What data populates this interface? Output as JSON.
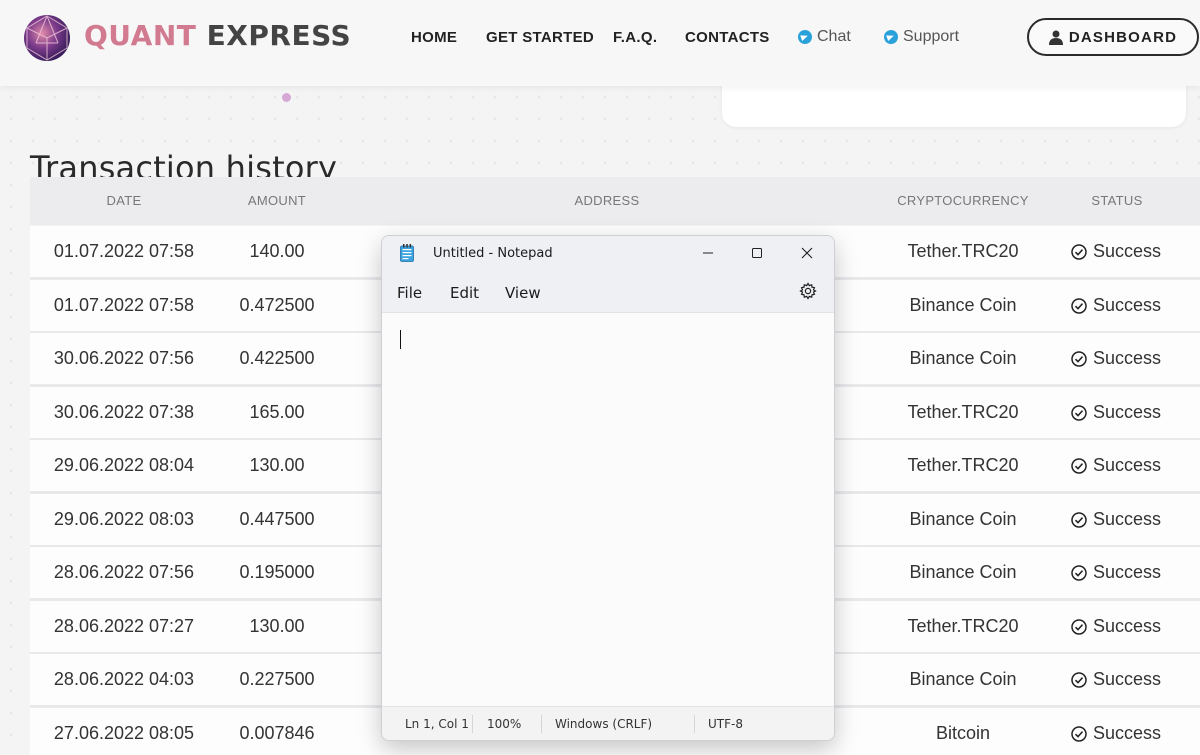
{
  "brand": {
    "part1": "QUANT",
    "part2": "EXPRESS"
  },
  "nav": {
    "home": "HOME",
    "get_started": "GET STARTED",
    "faq": "F.A.Q.",
    "contacts": "CONTACTS",
    "chat": "Chat",
    "support": "Support",
    "dashboard": "DASHBOARD"
  },
  "page_title": "Transaction history",
  "table": {
    "headers": {
      "date": "DATE",
      "amount": "AMOUNT",
      "address": "ADDRESS",
      "crypto": "CRYPTOCURRENCY",
      "status": "STATUS"
    },
    "rows": [
      {
        "date": "01.07.2022 07:58",
        "amount": "140.00",
        "crypto": "Tether.TRC20",
        "status": "Success"
      },
      {
        "date": "01.07.2022 07:58",
        "amount": "0.472500",
        "crypto": "Binance Coin",
        "status": "Success"
      },
      {
        "date": "30.06.2022 07:56",
        "amount": "0.422500",
        "crypto": "Binance Coin",
        "status": "Success"
      },
      {
        "date": "30.06.2022 07:38",
        "amount": "165.00",
        "crypto": "Tether.TRC20",
        "status": "Success"
      },
      {
        "date": "29.06.2022 08:04",
        "amount": "130.00",
        "crypto": "Tether.TRC20",
        "status": "Success"
      },
      {
        "date": "29.06.2022 08:03",
        "amount": "0.447500",
        "crypto": "Binance Coin",
        "status": "Success"
      },
      {
        "date": "28.06.2022 07:56",
        "amount": "0.195000",
        "crypto": "Binance Coin",
        "status": "Success"
      },
      {
        "date": "28.06.2022 07:27",
        "amount": "130.00",
        "crypto": "Tether.TRC20",
        "status": "Success"
      },
      {
        "date": "28.06.2022 04:03",
        "amount": "0.227500",
        "crypto": "Binance Coin",
        "status": "Success"
      },
      {
        "date": "27.06.2022 08:05",
        "amount": "0.007846",
        "crypto": "Bitcoin",
        "status": "Success"
      }
    ]
  },
  "notepad": {
    "title": "Untitled - Notepad",
    "menu": {
      "file": "File",
      "edit": "Edit",
      "view": "View"
    },
    "status": {
      "position": "Ln 1, Col 1",
      "zoom": "100%",
      "line_endings": "Windows (CRLF)",
      "encoding": "UTF-8"
    }
  },
  "colors": {
    "brand_pink": "#d27a8f",
    "telegram": "#2aa1da"
  },
  "icons": {
    "logo": "polyhedron-logo",
    "chat": "telegram-icon",
    "support": "telegram-icon",
    "dashboard": "user-icon",
    "status": "check-circle-icon",
    "settings": "gear-icon"
  }
}
